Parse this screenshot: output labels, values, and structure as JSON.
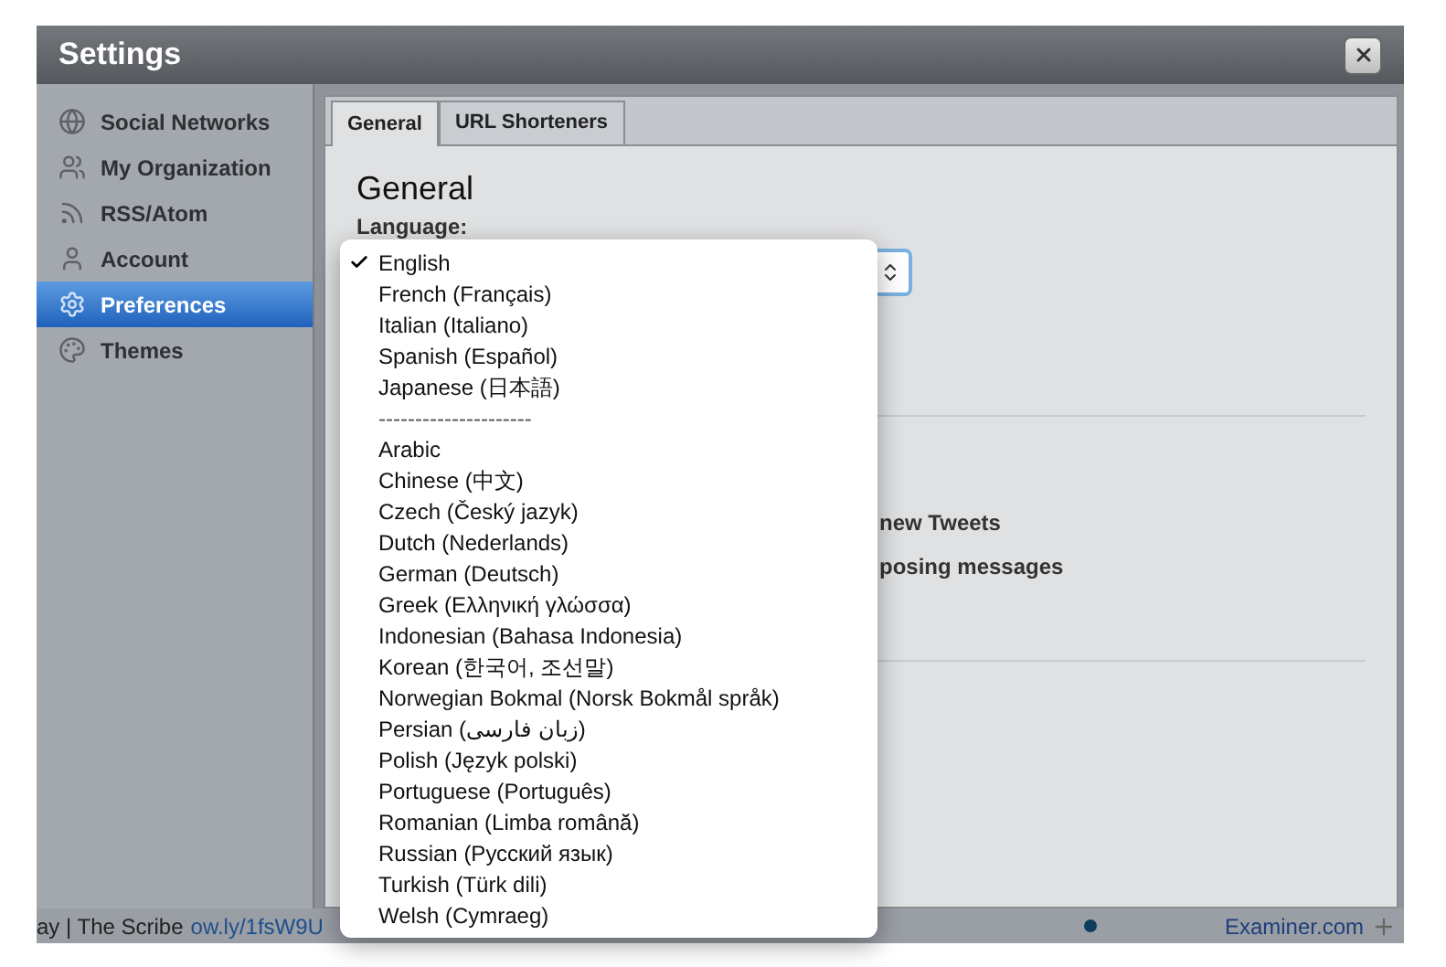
{
  "window": {
    "title": "Settings"
  },
  "sidebar": {
    "items": [
      {
        "label": "Social Networks",
        "selected": false
      },
      {
        "label": "My Organization",
        "selected": false
      },
      {
        "label": "RSS/Atom",
        "selected": false
      },
      {
        "label": "Account",
        "selected": false
      },
      {
        "label": "Preferences",
        "selected": true
      },
      {
        "label": "Themes",
        "selected": false
      }
    ]
  },
  "tabs": [
    {
      "label": "General",
      "selected": true
    },
    {
      "label": "URL Shorteners",
      "selected": false
    }
  ],
  "section": {
    "heading": "General",
    "language_label": "Language:"
  },
  "partial_texts": [
    "new Tweets",
    "posing messages"
  ],
  "language_menu": [
    {
      "kind": "option",
      "label": "English",
      "selected": true
    },
    {
      "kind": "option",
      "label": "French (Français)",
      "selected": false
    },
    {
      "kind": "option",
      "label": "Italian (Italiano)",
      "selected": false
    },
    {
      "kind": "option",
      "label": "Spanish (Español)",
      "selected": false
    },
    {
      "kind": "option",
      "label": "Japanese (日本語)",
      "selected": false
    },
    {
      "kind": "separator",
      "label": "---------------------"
    },
    {
      "kind": "option",
      "label": "Arabic",
      "selected": false
    },
    {
      "kind": "option",
      "label": "Chinese (中文)",
      "selected": false
    },
    {
      "kind": "option",
      "label": "Czech (Český jazyk)",
      "selected": false
    },
    {
      "kind": "option",
      "label": "Dutch (Nederlands)",
      "selected": false
    },
    {
      "kind": "option",
      "label": "German (Deutsch)",
      "selected": false
    },
    {
      "kind": "option",
      "label": "Greek (Ελληνική γλώσσα)",
      "selected": false
    },
    {
      "kind": "option",
      "label": "Indonesian (Bahasa Indonesia)",
      "selected": false
    },
    {
      "kind": "option",
      "label": "Korean (한국어, 조선말)",
      "selected": false
    },
    {
      "kind": "option",
      "label": "Norwegian Bokmal (Norsk Bokmål språk)",
      "selected": false
    },
    {
      "kind": "option",
      "label": "Persian (زبان فارسی)",
      "selected": false
    },
    {
      "kind": "option",
      "label": "Polish (Język polski)",
      "selected": false
    },
    {
      "kind": "option",
      "label": "Portuguese (Português)",
      "selected": false
    },
    {
      "kind": "option",
      "label": "Romanian (Limba română)",
      "selected": false
    },
    {
      "kind": "option",
      "label": "Russian (Русский язык)",
      "selected": false
    },
    {
      "kind": "option",
      "label": "Turkish (Türk dili)",
      "selected": false
    },
    {
      "kind": "option",
      "label": "Welsh (Cymraeg)",
      "selected": false
    }
  ],
  "background_strip": {
    "text": "ay | The Scribe",
    "link": "ow.ly/1fsW9U",
    "right_link": "Examiner.com"
  }
}
